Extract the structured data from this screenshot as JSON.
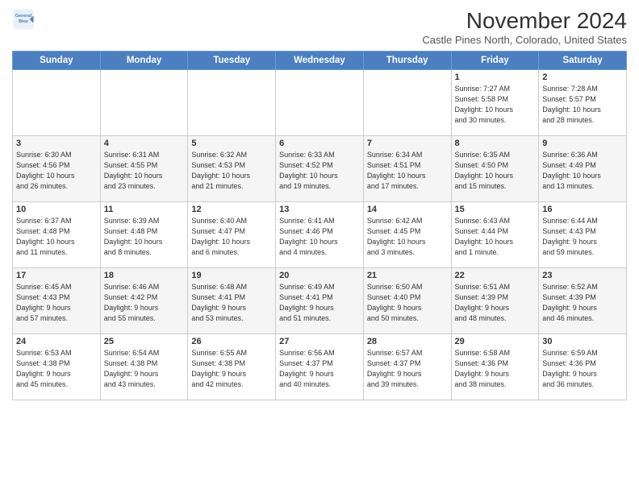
{
  "header": {
    "logo_line1": "General",
    "logo_line2": "Blue",
    "month_title": "November 2024",
    "subtitle": "Castle Pines North, Colorado, United States"
  },
  "days_of_week": [
    "Sunday",
    "Monday",
    "Tuesday",
    "Wednesday",
    "Thursday",
    "Friday",
    "Saturday"
  ],
  "weeks": [
    [
      {
        "day": "",
        "detail": ""
      },
      {
        "day": "",
        "detail": ""
      },
      {
        "day": "",
        "detail": ""
      },
      {
        "day": "",
        "detail": ""
      },
      {
        "day": "",
        "detail": ""
      },
      {
        "day": "1",
        "detail": "Sunrise: 7:27 AM\nSunset: 5:58 PM\nDaylight: 10 hours\nand 30 minutes."
      },
      {
        "day": "2",
        "detail": "Sunrise: 7:28 AM\nSunset: 5:57 PM\nDaylight: 10 hours\nand 28 minutes."
      }
    ],
    [
      {
        "day": "3",
        "detail": "Sunrise: 6:30 AM\nSunset: 4:56 PM\nDaylight: 10 hours\nand 26 minutes."
      },
      {
        "day": "4",
        "detail": "Sunrise: 6:31 AM\nSunset: 4:55 PM\nDaylight: 10 hours\nand 23 minutes."
      },
      {
        "day": "5",
        "detail": "Sunrise: 6:32 AM\nSunset: 4:53 PM\nDaylight: 10 hours\nand 21 minutes."
      },
      {
        "day": "6",
        "detail": "Sunrise: 6:33 AM\nSunset: 4:52 PM\nDaylight: 10 hours\nand 19 minutes."
      },
      {
        "day": "7",
        "detail": "Sunrise: 6:34 AM\nSunset: 4:51 PM\nDaylight: 10 hours\nand 17 minutes."
      },
      {
        "day": "8",
        "detail": "Sunrise: 6:35 AM\nSunset: 4:50 PM\nDaylight: 10 hours\nand 15 minutes."
      },
      {
        "day": "9",
        "detail": "Sunrise: 6:36 AM\nSunset: 4:49 PM\nDaylight: 10 hours\nand 13 minutes."
      }
    ],
    [
      {
        "day": "10",
        "detail": "Sunrise: 6:37 AM\nSunset: 4:48 PM\nDaylight: 10 hours\nand 11 minutes."
      },
      {
        "day": "11",
        "detail": "Sunrise: 6:39 AM\nSunset: 4:48 PM\nDaylight: 10 hours\nand 8 minutes."
      },
      {
        "day": "12",
        "detail": "Sunrise: 6:40 AM\nSunset: 4:47 PM\nDaylight: 10 hours\nand 6 minutes."
      },
      {
        "day": "13",
        "detail": "Sunrise: 6:41 AM\nSunset: 4:46 PM\nDaylight: 10 hours\nand 4 minutes."
      },
      {
        "day": "14",
        "detail": "Sunrise: 6:42 AM\nSunset: 4:45 PM\nDaylight: 10 hours\nand 3 minutes."
      },
      {
        "day": "15",
        "detail": "Sunrise: 6:43 AM\nSunset: 4:44 PM\nDaylight: 10 hours\nand 1 minute."
      },
      {
        "day": "16",
        "detail": "Sunrise: 6:44 AM\nSunset: 4:43 PM\nDaylight: 9 hours\nand 59 minutes."
      }
    ],
    [
      {
        "day": "17",
        "detail": "Sunrise: 6:45 AM\nSunset: 4:43 PM\nDaylight: 9 hours\nand 57 minutes."
      },
      {
        "day": "18",
        "detail": "Sunrise: 6:46 AM\nSunset: 4:42 PM\nDaylight: 9 hours\nand 55 minutes."
      },
      {
        "day": "19",
        "detail": "Sunrise: 6:48 AM\nSunset: 4:41 PM\nDaylight: 9 hours\nand 53 minutes."
      },
      {
        "day": "20",
        "detail": "Sunrise: 6:49 AM\nSunset: 4:41 PM\nDaylight: 9 hours\nand 51 minutes."
      },
      {
        "day": "21",
        "detail": "Sunrise: 6:50 AM\nSunset: 4:40 PM\nDaylight: 9 hours\nand 50 minutes."
      },
      {
        "day": "22",
        "detail": "Sunrise: 6:51 AM\nSunset: 4:39 PM\nDaylight: 9 hours\nand 48 minutes."
      },
      {
        "day": "23",
        "detail": "Sunrise: 6:52 AM\nSunset: 4:39 PM\nDaylight: 9 hours\nand 46 minutes."
      }
    ],
    [
      {
        "day": "24",
        "detail": "Sunrise: 6:53 AM\nSunset: 4:38 PM\nDaylight: 9 hours\nand 45 minutes."
      },
      {
        "day": "25",
        "detail": "Sunrise: 6:54 AM\nSunset: 4:38 PM\nDaylight: 9 hours\nand 43 minutes."
      },
      {
        "day": "26",
        "detail": "Sunrise: 6:55 AM\nSunset: 4:38 PM\nDaylight: 9 hours\nand 42 minutes."
      },
      {
        "day": "27",
        "detail": "Sunrise: 6:56 AM\nSunset: 4:37 PM\nDaylight: 9 hours\nand 40 minutes."
      },
      {
        "day": "28",
        "detail": "Sunrise: 6:57 AM\nSunset: 4:37 PM\nDaylight: 9 hours\nand 39 minutes."
      },
      {
        "day": "29",
        "detail": "Sunrise: 6:58 AM\nSunset: 4:36 PM\nDaylight: 9 hours\nand 38 minutes."
      },
      {
        "day": "30",
        "detail": "Sunrise: 6:59 AM\nSunset: 4:36 PM\nDaylight: 9 hours\nand 36 minutes."
      }
    ]
  ]
}
